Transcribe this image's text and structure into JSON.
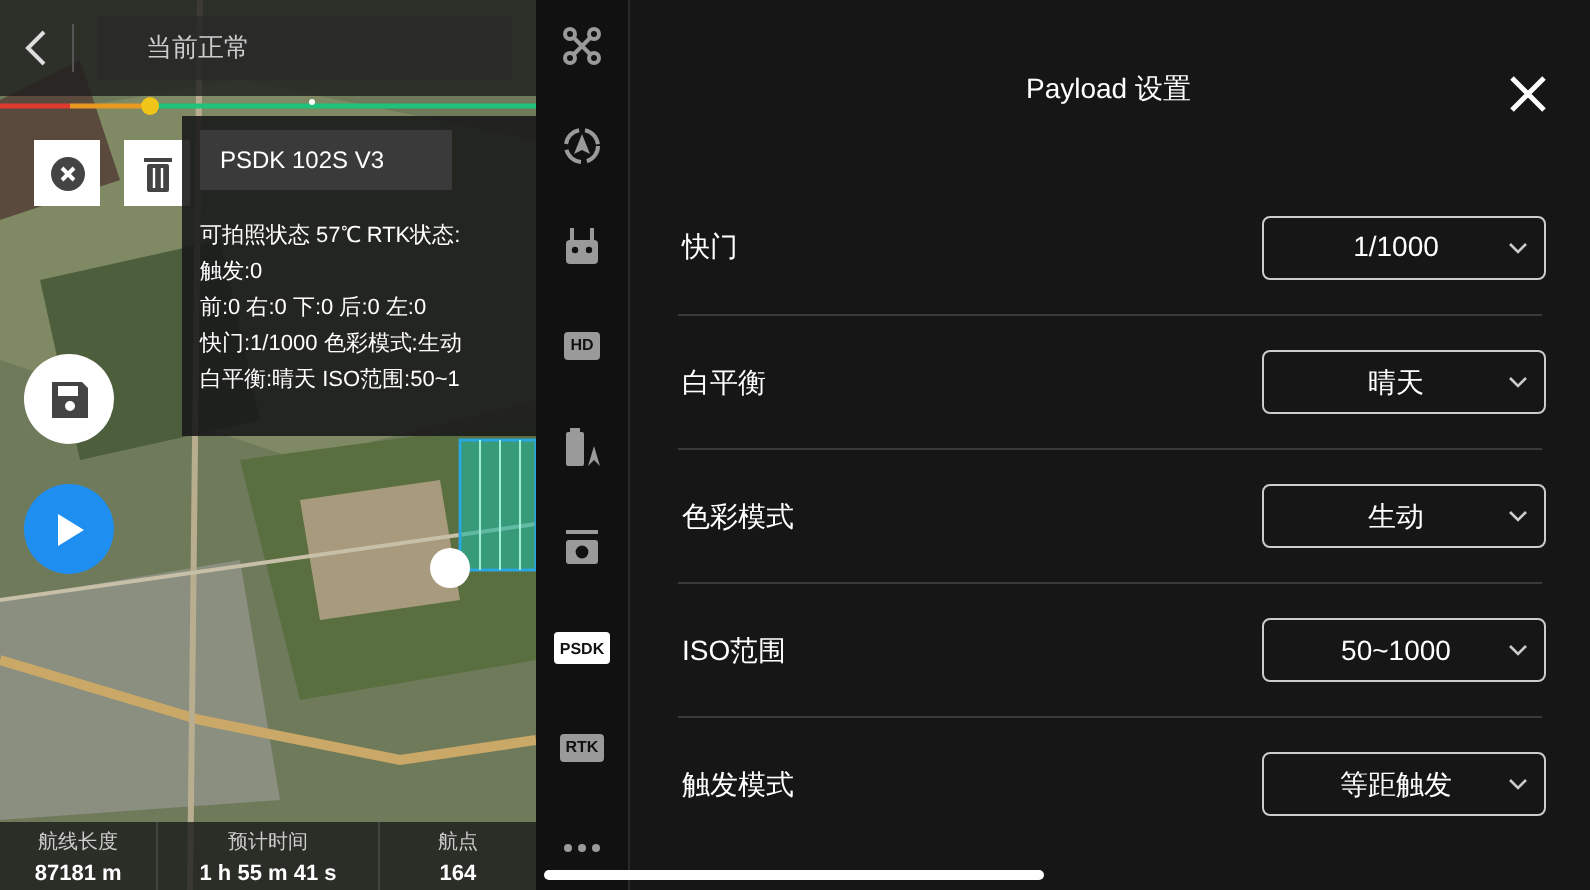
{
  "map_header": {
    "status": "当前正常"
  },
  "route_progress": {
    "level": 0.28
  },
  "payload_card": {
    "title": "PSDK  102S  V3",
    "lines": [
      "可拍照状态 57℃ RTK状态:",
      "触发:0",
      "前:0  右:0  下:0  后:0  左:0",
      "快门:1/1000  色彩模式:生动",
      "白平衡:晴天   ISO范围:50~1"
    ]
  },
  "stats": [
    {
      "label": "航线长度",
      "value": "87181 m"
    },
    {
      "label": "预计时间",
      "value": "1 h 55 m 41 s"
    },
    {
      "label": "航点",
      "value": "164"
    }
  ],
  "sidebar": {
    "items": [
      {
        "kind": "drone",
        "selected": false
      },
      {
        "kind": "compass",
        "selected": false
      },
      {
        "kind": "remote",
        "selected": false
      },
      {
        "kind": "text",
        "label": "HD",
        "selected": false
      },
      {
        "kind": "battery",
        "selected": false
      },
      {
        "kind": "camera",
        "selected": false
      },
      {
        "kind": "text",
        "label": "PSDK",
        "selected": true
      },
      {
        "kind": "text",
        "label": "RTK",
        "selected": false
      },
      {
        "kind": "more",
        "selected": false
      }
    ]
  },
  "dialog": {
    "title": "Payload 设置",
    "settings": [
      {
        "label": "快门",
        "value": "1/1000"
      },
      {
        "label": "白平衡",
        "value": "晴天"
      },
      {
        "label": "色彩模式",
        "value": "生动"
      },
      {
        "label": "ISO范围",
        "value": "50~1000"
      },
      {
        "label": "触发模式",
        "value": "等距触发"
      }
    ]
  }
}
